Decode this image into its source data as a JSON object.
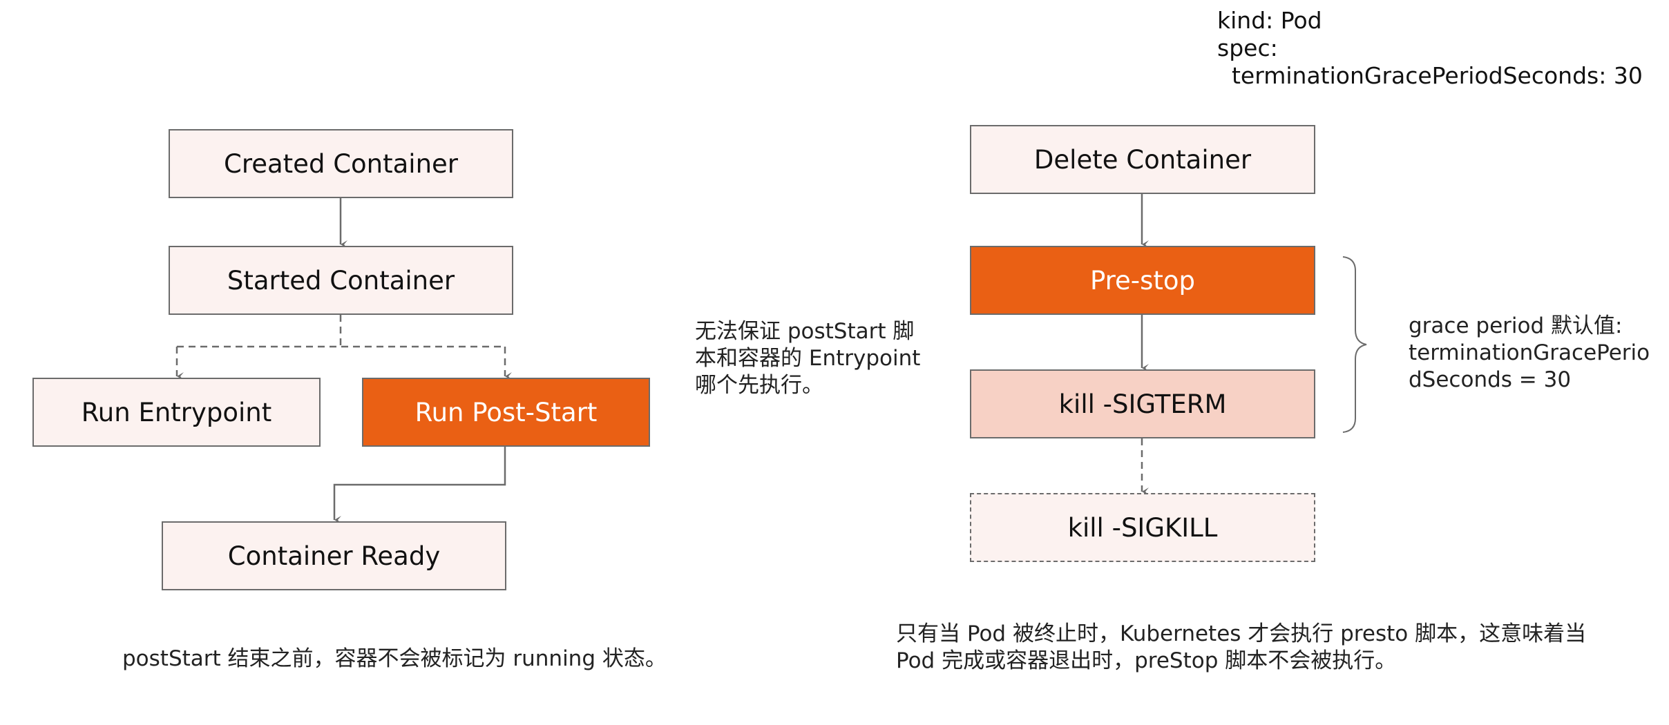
{
  "left_flow": {
    "nodes": {
      "created": "Created Container",
      "started": "Started Container",
      "entrypoint": "Run Entrypoint",
      "post_start": "Run Post-Start",
      "ready": "Container Ready"
    },
    "side_note": "无法保证 postStart 脚\n本和容器的 Entrypoint\n哪个先执行。",
    "caption": "postStart 结束之前，容器不会被标记为 running 状态。"
  },
  "right_flow": {
    "yaml": "kind: Pod\nspec:\n  terminationGracePeriodSeconds: 30",
    "nodes": {
      "delete": "Delete Container",
      "pre_stop": "Pre-stop",
      "sigterm": "kill -SIGTERM",
      "sigkill": "kill -SIGKILL"
    },
    "brace_note": "grace period 默认值:\nterminationGracePerio\ndSeconds = 30",
    "caption": "只有当 Pod 被终止时，Kubernetes 才会执行 presto 脚本，这意味着当\nPod 完成或容器退出时，preStop 脚本不会被执行。"
  },
  "colors": {
    "accent": "#ea6014",
    "box_fill": "#fcf2f0",
    "box_fill_light": "#f7d1c5",
    "line": "#6b6b6b"
  }
}
